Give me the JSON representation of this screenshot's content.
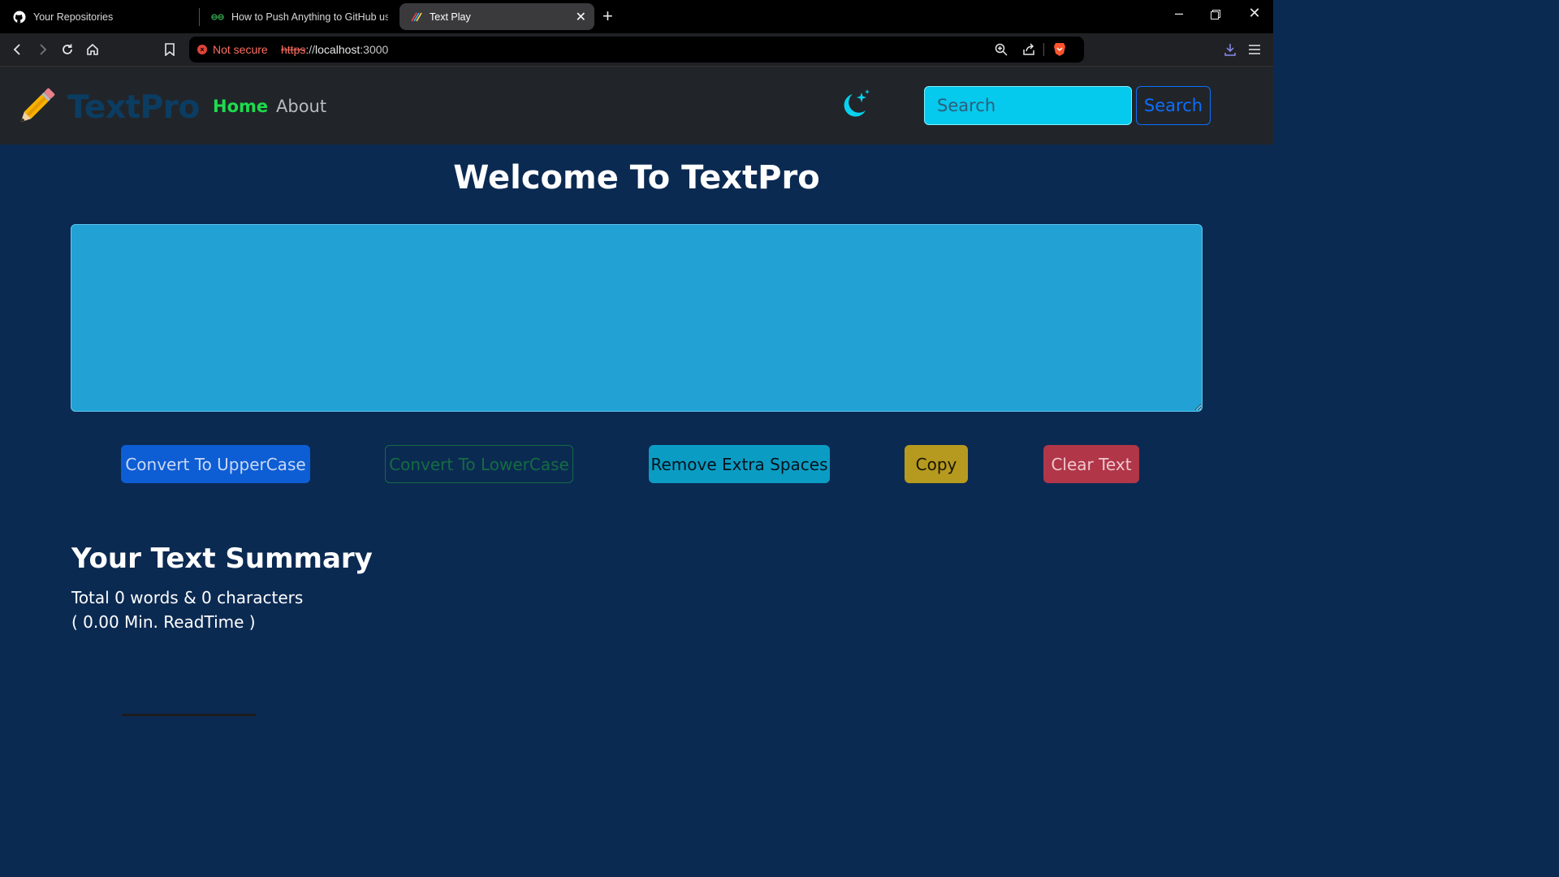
{
  "browser": {
    "tabs": [
      {
        "title": "Your Repositories",
        "icon": "github-icon"
      },
      {
        "title": "How to Push Anything to GitHub using",
        "icon": "geeksforgeeks-icon"
      },
      {
        "title": "Text Play",
        "icon": "react-app-icon",
        "active": true
      }
    ],
    "address": {
      "security_label": "Not secure",
      "scheme": "https",
      "rest": "://",
      "host": "localhost",
      "port": ":3000"
    }
  },
  "navbar": {
    "brand": "TextPro",
    "links": [
      {
        "label": "Home",
        "active": true
      },
      {
        "label": "About",
        "active": false
      }
    ],
    "search": {
      "placeholder": "Search",
      "button_label": "Search"
    },
    "dark_mode_icon": "moon-stars-icon"
  },
  "main": {
    "heading": "Welcome To TextPro",
    "textarea_value": "",
    "buttons": {
      "uppercase": "Convert To UpperCase",
      "lowercase": "Convert To LowerCase",
      "remove_spaces": "Remove Extra Spaces",
      "copy": "Copy",
      "clear": "Clear Text"
    },
    "summary": {
      "title": "Your Text Summary",
      "counts": "Total 0 words & 0 characters",
      "readtime": "( 0.00 Min. ReadTime )"
    }
  },
  "colors": {
    "page_bg": "#0b2a52",
    "navbar_bg": "#212529",
    "home_link": "#1edb4c",
    "textarea_bg": "#21a1d4",
    "search_input_bg": "#05c9ed",
    "btn_upper": "#0d5dd4",
    "btn_spaces": "#0b9cc4",
    "btn_copy": "#b69a1f",
    "btn_clear": "#b03648"
  }
}
